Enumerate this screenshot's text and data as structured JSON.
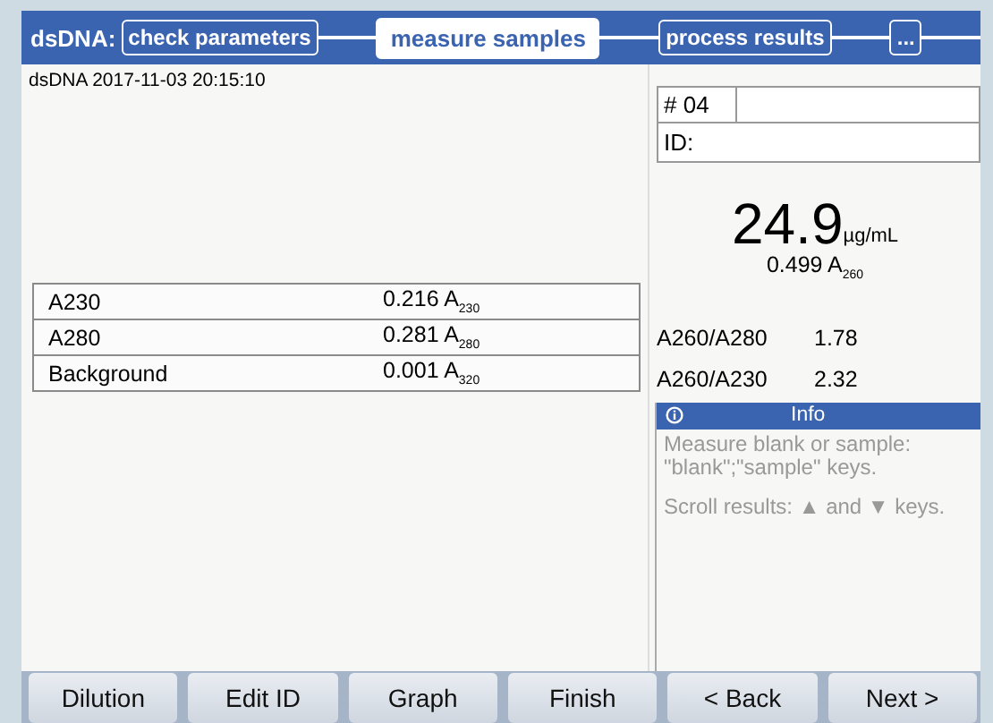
{
  "header": {
    "method": "dsDNA:",
    "steps": [
      {
        "label": "check parameters",
        "selected": false
      },
      {
        "label": "measure samples",
        "selected": true
      },
      {
        "label": "process results",
        "selected": false
      },
      {
        "label": "...",
        "selected": false
      }
    ]
  },
  "timestamp": "dsDNA 2017-11-03 20:15:10",
  "sample": {
    "number": "# 04",
    "id_label": "ID:"
  },
  "readings": [
    {
      "name": "A230",
      "value": "0.216 A$_{230}$"
    },
    {
      "name": "A280",
      "value": "0.281 A$_{280}$"
    },
    {
      "name": "Background",
      "value": "0.001 A$_{320}$"
    }
  ],
  "result": {
    "concentration": "24.9",
    "unit": "µg/mL",
    "absorbance": "0.499 A$_{260}$"
  },
  "ratios": [
    {
      "name": "A260/A280",
      "value": "1.78"
    },
    {
      "name": "A260/A230",
      "value": "2.32"
    }
  ],
  "info": {
    "title": "Info",
    "messages": [
      "Measure blank or sample: \"blank\";\"sample\" keys.",
      "Scroll results: ▲ and ▼ keys."
    ]
  },
  "buttons": [
    "Dilution",
    "Edit ID",
    "Graph",
    "Finish",
    "< Back",
    "Next >"
  ]
}
